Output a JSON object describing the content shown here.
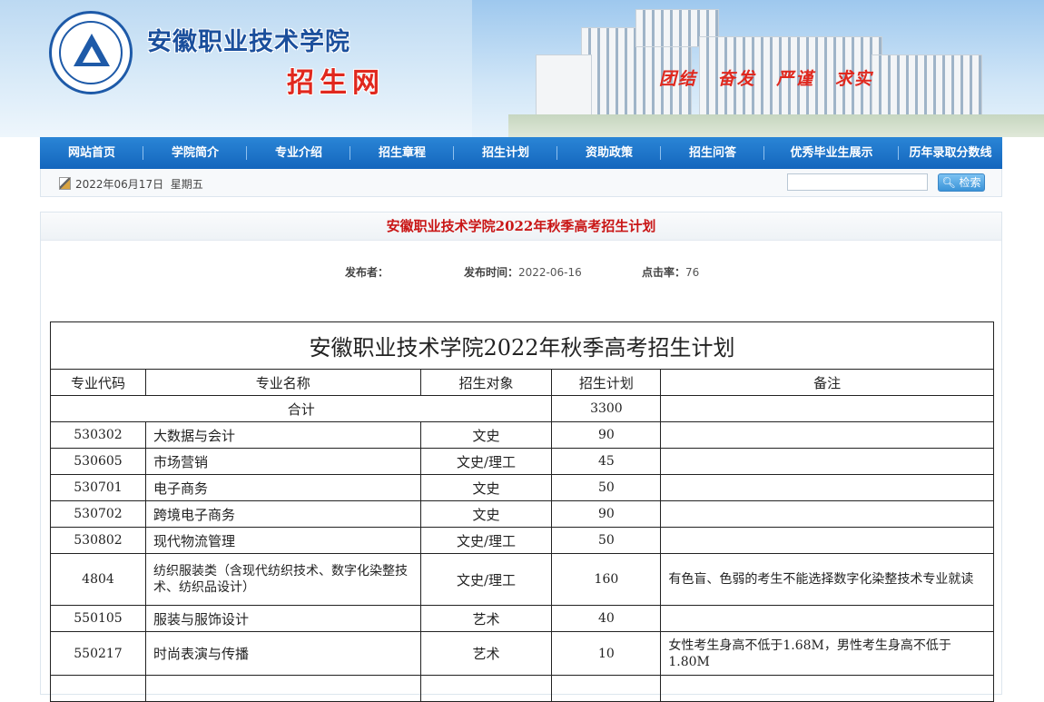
{
  "header": {
    "site_title": "安徽职业技术学院",
    "site_subtitle": "招生网",
    "motto": [
      "团结",
      "奋发",
      "严谨",
      "求实"
    ]
  },
  "nav": {
    "items": [
      "网站首页",
      "学院简介",
      "专业介绍",
      "招生章程",
      "招生计划",
      "资助政策",
      "招生问答",
      "优秀毕业生展示",
      "历年录取分数线"
    ]
  },
  "datebar": {
    "date": "2022年06月17日",
    "weekday": "星期五",
    "search_placeholder": "",
    "search_button": "检索"
  },
  "article": {
    "title": "安徽职业技术学院2022年秋季高考招生计划",
    "publisher_label": "发布者：",
    "publisher": "",
    "time_label": "发布时间：",
    "time": "2022-06-16",
    "clicks_label": "点击率：",
    "clicks": "76"
  },
  "table": {
    "caption": "安徽职业技术学院2022年秋季高考招生计划",
    "headers": [
      "专业代码",
      "专业名称",
      "招生对象",
      "招生计划",
      "备注"
    ],
    "total_label": "合计",
    "total_value": "3300",
    "rows": [
      {
        "code": "530302",
        "name": "大数据与会计",
        "target": "文史",
        "plan": "90",
        "note": ""
      },
      {
        "code": "530605",
        "name": "市场营销",
        "target": "文史/理工",
        "plan": "45",
        "note": ""
      },
      {
        "code": "530701",
        "name": "电子商务",
        "target": "文史",
        "plan": "50",
        "note": ""
      },
      {
        "code": "530702",
        "name": "跨境电子商务",
        "target": "文史",
        "plan": "90",
        "note": ""
      },
      {
        "code": "530802",
        "name": "现代物流管理",
        "target": "文史/理工",
        "plan": "50",
        "note": ""
      },
      {
        "code": "4804",
        "name": "纺织服装类（含现代纺织技术、数字化染整技术、纺织品设计）",
        "target": "文史/理工",
        "plan": "160",
        "note": "有色盲、色弱的考生不能选择数字化染整技术专业就读"
      },
      {
        "code": "550105",
        "name": "服装与服饰设计",
        "target": "艺术",
        "plan": "40",
        "note": ""
      },
      {
        "code": "550217",
        "name": "时尚表演与传播",
        "target": "艺术",
        "plan": "10",
        "note": "女性考生身高不低于1.68M，男性考生身高不低于1.80M"
      }
    ]
  }
}
